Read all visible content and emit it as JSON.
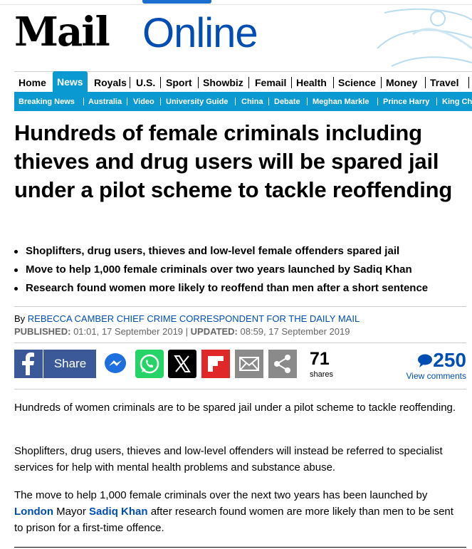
{
  "brand": {
    "mail": "Mail",
    "online": "Online"
  },
  "nav": {
    "items": [
      "Home",
      "News",
      "Royals",
      "U.S.",
      "Sport",
      "Showbiz",
      "Femail",
      "Health",
      "Science",
      "Money",
      "Travel"
    ],
    "active": "News"
  },
  "subnav": {
    "items": [
      "Breaking News",
      "Australia",
      "Video",
      "University Guide",
      "China",
      "Debate",
      "Meghan Markle",
      "Prince Harry",
      "King Ch"
    ]
  },
  "article": {
    "headline": "Hundreds of female criminals including thieves and drug users will be spared jail under a pilot scheme to tackle reoffending",
    "bullets": [
      "Shoplifters, drug users, thieves and low-level female offenders spared jail",
      "Move to help 1,000 female criminals over two years launched by Sadiq Khan",
      "Research found women more likely to reoffend than men after a short sentence"
    ],
    "byline_prefix": "By",
    "author": "REBECCA CAMBER CHIEF CRIME CORRESPONDENT FOR THE DAILY MAIL",
    "published_label": "PUBLISHED:",
    "published": "01:01, 17 September 2019",
    "updated_label": "UPDATED:",
    "updated": "08:59, 17 September 2019",
    "para1": "Hundreds of women criminals are to be spared jail under a pilot scheme to tackle reoffending.",
    "para2": "Shoplifters, drug users, thieves and low-level offenders will instead be referred to specialist services for help with mental health problems and substance abuse.",
    "para3_a": "The move to help 1,000 female criminals over the next two years has been launched by",
    "para3_link1": "London",
    "para3_b": "Mayor",
    "para3_link2": "Sadiq Khan",
    "para3_c": "after research found women are more likely than men to be sent to prison for a first-time offence."
  },
  "share": {
    "facebook_label": "Share",
    "count": "71",
    "count_label": "shares",
    "comments_count": "250",
    "comments_label": "View comments",
    "icons": [
      "facebook-icon",
      "messenger-icon",
      "whatsapp-icon",
      "x-icon",
      "flipboard-icon",
      "email-icon",
      "share-icon",
      "comment-bubble-icon"
    ]
  },
  "colors": {
    "brand_blue": "#004db3",
    "nav_active": "#0a99d0",
    "facebook": "#3b5998",
    "whatsapp": "#25d366",
    "flipboard": "#e12828"
  }
}
